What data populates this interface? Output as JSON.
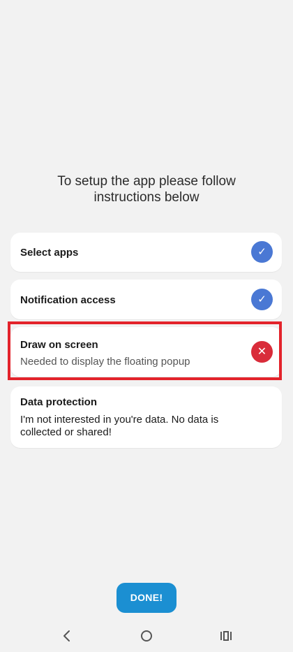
{
  "instructions": "To setup the app please follow instructions below",
  "cards": [
    {
      "title": "Select apps",
      "status": "done",
      "status_icon": "check-icon"
    },
    {
      "title": "Notification access",
      "status": "done",
      "status_icon": "check-icon"
    },
    {
      "title": "Draw on screen",
      "subtitle": "Needed to display the floating popup",
      "status": "missing",
      "status_icon": "close-icon"
    },
    {
      "title": "Data protection",
      "description": "I'm not interested in you're data. No data is collected or shared!"
    }
  ],
  "status_glyphs": {
    "check": "✓",
    "cross": "✕"
  },
  "done_button": "DONE!",
  "nav": {
    "back": "back-icon",
    "home": "home-icon",
    "recents": "recents-icon"
  },
  "colors": {
    "background": "#f2f2f2",
    "check_circle": "#4a78d4",
    "error_circle": "#d92c3a",
    "highlight": "#e3232b",
    "button": "#1b8fd2"
  }
}
